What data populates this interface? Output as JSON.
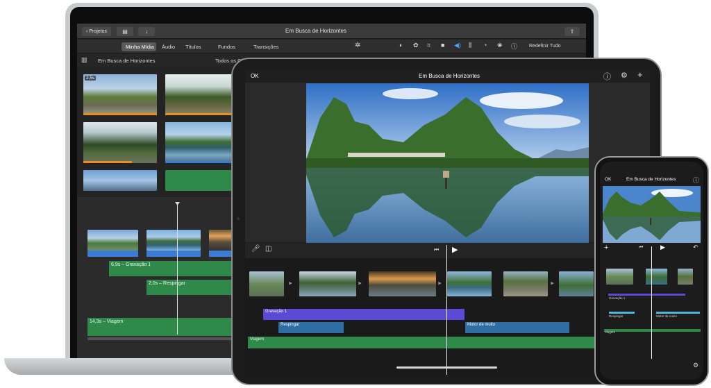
{
  "colors": {
    "mac_bg": "#2b2b2b",
    "toolbar": "#3a3a3a",
    "ipad_bg": "#1e1e1e",
    "green_track": "#2f8a4a",
    "blue_track": "#3a7bd5",
    "purple_track": "#5a4ad6",
    "accent_orange": "#e8901c"
  },
  "mac": {
    "back_button": "Projetos",
    "title": "Em Busca de Horizontes",
    "tabs": [
      "Minha Mídia",
      "Áudio",
      "Títulos",
      "Fundos",
      "Transições"
    ],
    "reset_label": "Redefinir Tudo",
    "library_title": "Em Busca de Horizontes",
    "filter_label": "Todos os Cl",
    "first_clip_badge": "2,5s",
    "tracks": {
      "recording": "6,9s – Gravação 1",
      "splash": "2,0s – Respingar",
      "journey": "14,3s – Viagem"
    }
  },
  "ipad": {
    "ok_label": "OK",
    "title": "Em Busca de Horizontes",
    "tracks": {
      "recording": "Gravação 1",
      "splash": "Respingar",
      "motor": "Motor de muito",
      "journey": "Viagem"
    }
  },
  "iphone": {
    "ok_label": "OK",
    "title": "Em Busca de Horizontes",
    "tracks": {
      "recording": "Gravação 1",
      "splash": "Respingar",
      "motor": "Motor de muito",
      "journey": "Viagem"
    }
  }
}
